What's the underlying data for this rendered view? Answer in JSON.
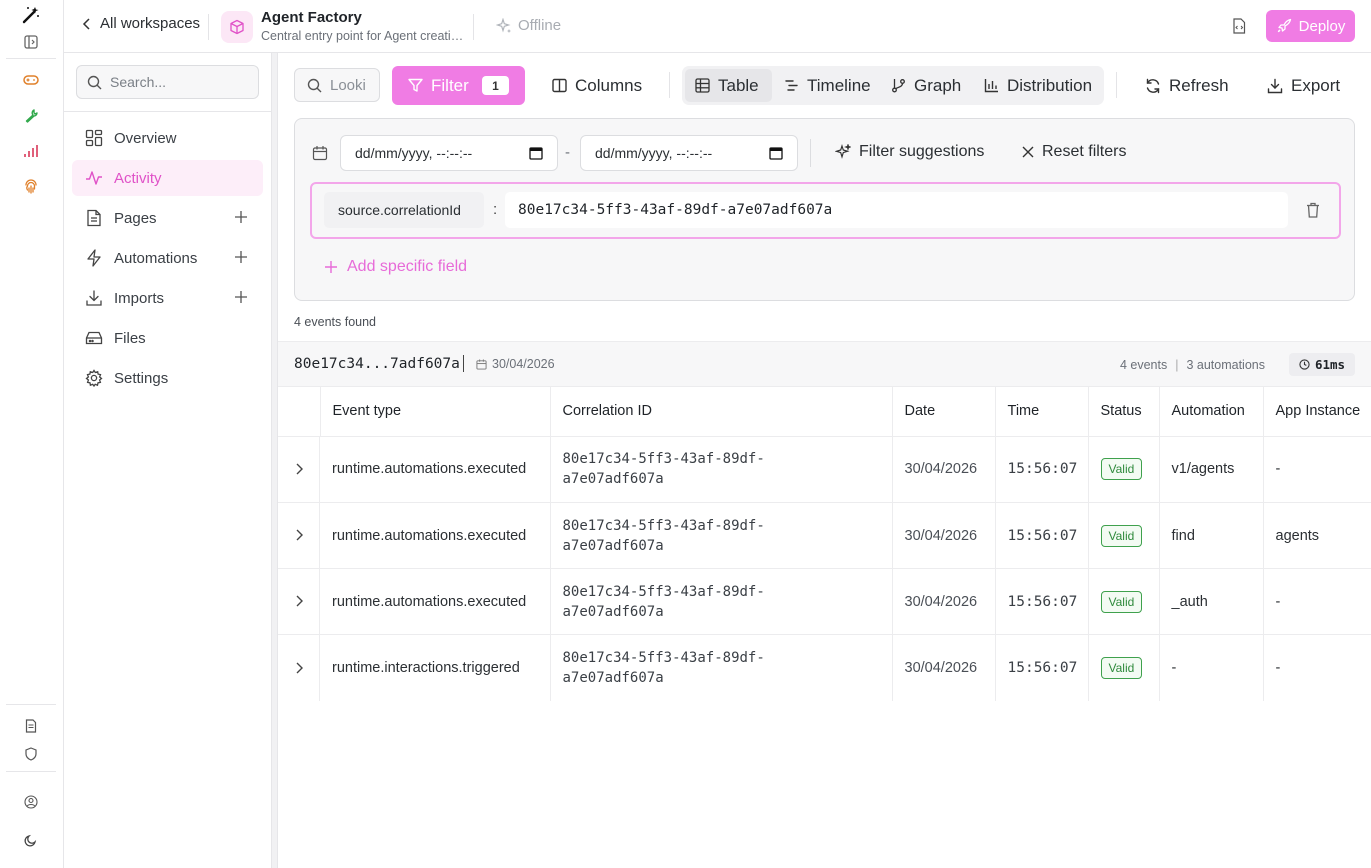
{
  "header": {
    "back_label": "All workspaces",
    "app_title": "Agent Factory",
    "app_subtitle": "Central entry point for Agent creatio...",
    "status": "Offline",
    "deploy_label": "Deploy"
  },
  "sidebar": {
    "search_placeholder": "Search...",
    "items": [
      {
        "label": "Overview"
      },
      {
        "label": "Activity"
      },
      {
        "label": "Pages"
      },
      {
        "label": "Automations"
      },
      {
        "label": "Imports"
      },
      {
        "label": "Files"
      },
      {
        "label": "Settings"
      }
    ]
  },
  "toolbar": {
    "search_placeholder": "Looki",
    "filter_label": "Filter",
    "filter_count": "1",
    "columns_label": "Columns",
    "views": [
      "Table",
      "Timeline",
      "Graph",
      "Distribution"
    ],
    "active_view": "Table",
    "refresh_label": "Refresh",
    "export_label": "Export"
  },
  "filters": {
    "date_from_placeholder": "dd/mm/yyyy, --:--:--",
    "date_to_placeholder": "dd/mm/yyyy, --:--:--",
    "date_separator": "-",
    "suggestions_label": "Filter suggestions",
    "reset_label": "Reset filters",
    "field_key": "source.correlationId",
    "field_separator": ":",
    "field_value": "80e17c34-5ff3-43af-89df-a7e07adf607a",
    "add_field_label": "Add specific field"
  },
  "results": {
    "count_text": "4 events found",
    "group": {
      "id": "80e17c34...7adf607a",
      "date": "30/04/2026",
      "events": "4 events",
      "automations": "3 automations",
      "duration": "61ms"
    },
    "columns": [
      "Event type",
      "Correlation ID",
      "Date",
      "Time",
      "Status",
      "Automation",
      "App Instance"
    ],
    "rows": [
      {
        "event_type": "runtime.automations.executed",
        "corr1": "80e17c34-5ff3-43af-89df-",
        "corr2": "a7e07adf607a",
        "date": "30/04/2026",
        "time": "15:56:07",
        "status": "Valid",
        "automation": "v1/agents",
        "app_instance": "-"
      },
      {
        "event_type": "runtime.automations.executed",
        "corr1": "80e17c34-5ff3-43af-89df-",
        "corr2": "a7e07adf607a",
        "date": "30/04/2026",
        "time": "15:56:07",
        "status": "Valid",
        "automation": "find",
        "app_instance": "agents"
      },
      {
        "event_type": "runtime.automations.executed",
        "corr1": "80e17c34-5ff3-43af-89df-",
        "corr2": "a7e07adf607a",
        "date": "30/04/2026",
        "time": "15:56:07",
        "status": "Valid",
        "automation": "_auth",
        "app_instance": "-"
      },
      {
        "event_type": "runtime.interactions.triggered",
        "corr1": "80e17c34-5ff3-43af-89df-",
        "corr2": "a7e07adf607a",
        "date": "30/04/2026",
        "time": "15:56:07",
        "status": "Valid",
        "automation": "-",
        "app_instance": "-"
      }
    ]
  },
  "colors": {
    "accent": "#f07ce4",
    "accent_text": "#e052c8",
    "valid": "#2f8a3c"
  }
}
